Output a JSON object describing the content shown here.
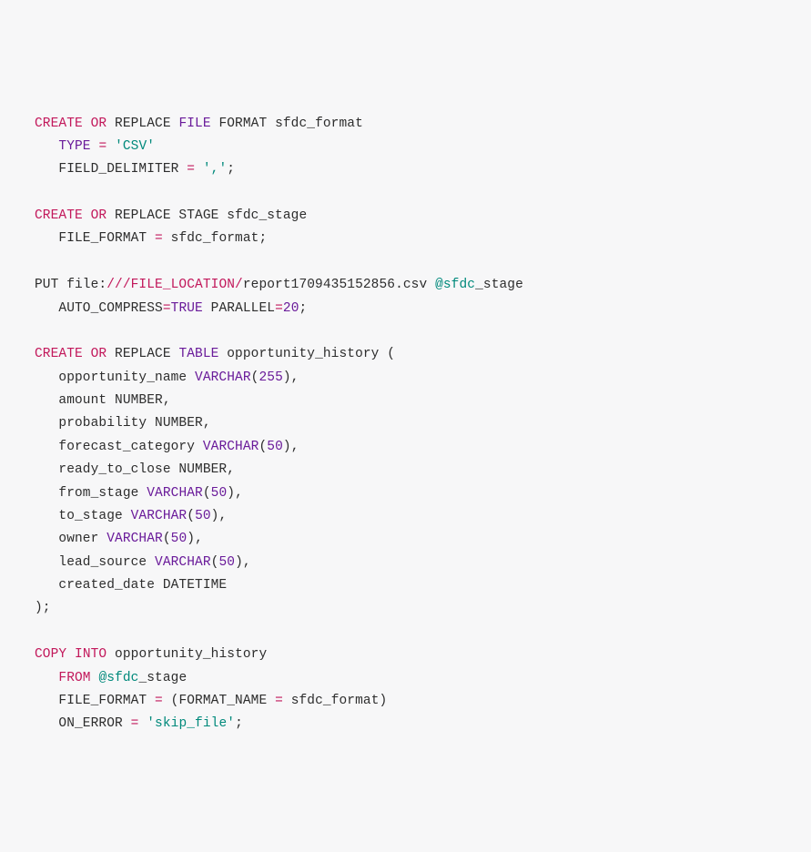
{
  "code": {
    "lines": [
      {
        "indent": 0,
        "tokens": [
          {
            "t": "CREATE OR",
            "c": "kw"
          },
          {
            "t": " REPLACE ",
            "c": "txt"
          },
          {
            "t": "FILE",
            "c": "fn"
          },
          {
            "t": " FORMAT sfdc_format",
            "c": "txt"
          }
        ]
      },
      {
        "indent": 1,
        "tokens": [
          {
            "t": "TYPE",
            "c": "fn"
          },
          {
            "t": " ",
            "c": "txt"
          },
          {
            "t": "=",
            "c": "kw"
          },
          {
            "t": " ",
            "c": "txt"
          },
          {
            "t": "'CSV'",
            "c": "str"
          }
        ]
      },
      {
        "indent": 1,
        "tokens": [
          {
            "t": "FIELD_DELIMITER ",
            "c": "txt"
          },
          {
            "t": "=",
            "c": "kw"
          },
          {
            "t": " ",
            "c": "txt"
          },
          {
            "t": "','",
            "c": "str"
          },
          {
            "t": ";",
            "c": "txt"
          }
        ]
      },
      {
        "indent": 0,
        "tokens": []
      },
      {
        "indent": 0,
        "tokens": [
          {
            "t": "CREATE OR",
            "c": "kw"
          },
          {
            "t": " REPLACE STAGE sfdc_stage",
            "c": "txt"
          }
        ]
      },
      {
        "indent": 1,
        "tokens": [
          {
            "t": "FILE_FORMAT ",
            "c": "txt"
          },
          {
            "t": "=",
            "c": "kw"
          },
          {
            "t": " sfdc_format;",
            "c": "txt"
          }
        ]
      },
      {
        "indent": 0,
        "tokens": []
      },
      {
        "indent": 0,
        "tokens": [
          {
            "t": "PUT file:",
            "c": "txt"
          },
          {
            "t": "///FILE_LOCATION/",
            "c": "kw"
          },
          {
            "t": "report1709435152856.csv ",
            "c": "txt"
          },
          {
            "t": "@sfdc",
            "c": "at"
          },
          {
            "t": "_stage",
            "c": "txt"
          }
        ]
      },
      {
        "indent": 1,
        "tokens": [
          {
            "t": "AUTO_COMPRESS",
            "c": "txt"
          },
          {
            "t": "=",
            "c": "kw"
          },
          {
            "t": "TRUE",
            "c": "num"
          },
          {
            "t": " PARALLEL",
            "c": "txt"
          },
          {
            "t": "=",
            "c": "kw"
          },
          {
            "t": "20",
            "c": "num"
          },
          {
            "t": ";",
            "c": "txt"
          }
        ]
      },
      {
        "indent": 0,
        "tokens": []
      },
      {
        "indent": 0,
        "tokens": [
          {
            "t": "CREATE OR",
            "c": "kw"
          },
          {
            "t": " REPLACE ",
            "c": "txt"
          },
          {
            "t": "TABLE",
            "c": "fn"
          },
          {
            "t": " opportunity_history (",
            "c": "txt"
          }
        ]
      },
      {
        "indent": 1,
        "tokens": [
          {
            "t": "opportunity_name ",
            "c": "txt"
          },
          {
            "t": "VARCHAR",
            "c": "fn"
          },
          {
            "t": "(",
            "c": "txt"
          },
          {
            "t": "255",
            "c": "num"
          },
          {
            "t": "),",
            "c": "txt"
          }
        ]
      },
      {
        "indent": 1,
        "tokens": [
          {
            "t": "amount NUMBER,",
            "c": "txt"
          }
        ]
      },
      {
        "indent": 1,
        "tokens": [
          {
            "t": "probability NUMBER,",
            "c": "txt"
          }
        ]
      },
      {
        "indent": 1,
        "tokens": [
          {
            "t": "forecast_category ",
            "c": "txt"
          },
          {
            "t": "VARCHAR",
            "c": "fn"
          },
          {
            "t": "(",
            "c": "txt"
          },
          {
            "t": "50",
            "c": "num"
          },
          {
            "t": "),",
            "c": "txt"
          }
        ]
      },
      {
        "indent": 1,
        "tokens": [
          {
            "t": "ready_to_close NUMBER,",
            "c": "txt"
          }
        ]
      },
      {
        "indent": 1,
        "tokens": [
          {
            "t": "from_stage ",
            "c": "txt"
          },
          {
            "t": "VARCHAR",
            "c": "fn"
          },
          {
            "t": "(",
            "c": "txt"
          },
          {
            "t": "50",
            "c": "num"
          },
          {
            "t": "),",
            "c": "txt"
          }
        ]
      },
      {
        "indent": 1,
        "tokens": [
          {
            "t": "to_stage ",
            "c": "txt"
          },
          {
            "t": "VARCHAR",
            "c": "fn"
          },
          {
            "t": "(",
            "c": "txt"
          },
          {
            "t": "50",
            "c": "num"
          },
          {
            "t": "),",
            "c": "txt"
          }
        ]
      },
      {
        "indent": 1,
        "tokens": [
          {
            "t": "owner ",
            "c": "txt"
          },
          {
            "t": "VARCHAR",
            "c": "fn"
          },
          {
            "t": "(",
            "c": "txt"
          },
          {
            "t": "50",
            "c": "num"
          },
          {
            "t": "),",
            "c": "txt"
          }
        ]
      },
      {
        "indent": 1,
        "tokens": [
          {
            "t": "lead_source ",
            "c": "txt"
          },
          {
            "t": "VARCHAR",
            "c": "fn"
          },
          {
            "t": "(",
            "c": "txt"
          },
          {
            "t": "50",
            "c": "num"
          },
          {
            "t": "),",
            "c": "txt"
          }
        ]
      },
      {
        "indent": 1,
        "tokens": [
          {
            "t": "created_date DATETIME",
            "c": "txt"
          }
        ]
      },
      {
        "indent": 0,
        "tokens": [
          {
            "t": ");",
            "c": "txt"
          }
        ]
      },
      {
        "indent": 0,
        "tokens": []
      },
      {
        "indent": 0,
        "tokens": [
          {
            "t": "COPY",
            "c": "kw"
          },
          {
            "t": " ",
            "c": "txt"
          },
          {
            "t": "INTO",
            "c": "kw"
          },
          {
            "t": " opportunity_history",
            "c": "txt"
          }
        ]
      },
      {
        "indent": 1,
        "tokens": [
          {
            "t": "FROM",
            "c": "kw"
          },
          {
            "t": " ",
            "c": "txt"
          },
          {
            "t": "@sfdc",
            "c": "at"
          },
          {
            "t": "_stage",
            "c": "txt"
          }
        ]
      },
      {
        "indent": 1,
        "tokens": [
          {
            "t": "FILE_FORMAT ",
            "c": "txt"
          },
          {
            "t": "=",
            "c": "kw"
          },
          {
            "t": " (FORMAT_NAME ",
            "c": "txt"
          },
          {
            "t": "=",
            "c": "kw"
          },
          {
            "t": " sfdc_format)",
            "c": "txt"
          }
        ]
      },
      {
        "indent": 1,
        "tokens": [
          {
            "t": "ON_ERROR ",
            "c": "txt"
          },
          {
            "t": "=",
            "c": "kw"
          },
          {
            "t": " ",
            "c": "txt"
          },
          {
            "t": "'skip_file'",
            "c": "str"
          },
          {
            "t": ";",
            "c": "txt"
          }
        ]
      }
    ]
  }
}
